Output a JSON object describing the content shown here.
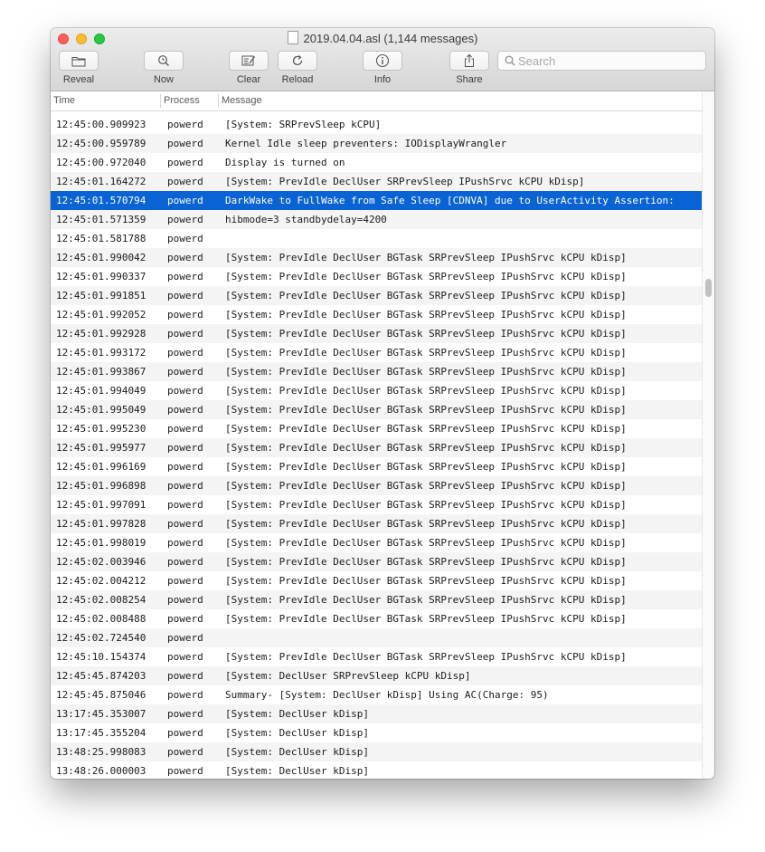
{
  "window": {
    "title": "2019.04.04.asl (1,144 messages)"
  },
  "toolbar": {
    "reveal_label": "Reveal",
    "now_label": "Now",
    "clear_label": "Clear",
    "reload_label": "Reload",
    "info_label": "Info",
    "share_label": "Share",
    "search_placeholder": "Search"
  },
  "columns": {
    "time": "Time",
    "process": "Process",
    "message": "Message"
  },
  "rows": [
    {
      "time": "12:45:00.909923",
      "process": "powerd",
      "message": "[System: SRPrevSleep kCPU]"
    },
    {
      "time": "12:45:00.959789",
      "process": "powerd",
      "message": "Kernel Idle sleep preventers: IODisplayWrangler"
    },
    {
      "time": "12:45:00.972040",
      "process": "powerd",
      "message": "Display is turned on"
    },
    {
      "time": "12:45:01.164272",
      "process": "powerd",
      "message": "[System: PrevIdle DeclUser SRPrevSleep IPushSrvc kCPU kDisp]"
    },
    {
      "time": "12:45:01.570794",
      "process": "powerd",
      "message": "DarkWake to FullWake from Safe Sleep [CDNVA] due to UserActivity Assertion:"
    },
    {
      "time": "12:45:01.571359",
      "process": "powerd",
      "message": "hibmode=3 standbydelay=4200"
    },
    {
      "time": "12:45:01.581788",
      "process": "powerd",
      "message": ""
    },
    {
      "time": "12:45:01.990042",
      "process": "powerd",
      "message": "[System: PrevIdle DeclUser BGTask SRPrevSleep IPushSrvc kCPU kDisp]"
    },
    {
      "time": "12:45:01.990337",
      "process": "powerd",
      "message": "[System: PrevIdle DeclUser BGTask SRPrevSleep IPushSrvc kCPU kDisp]"
    },
    {
      "time": "12:45:01.991851",
      "process": "powerd",
      "message": "[System: PrevIdle DeclUser BGTask SRPrevSleep IPushSrvc kCPU kDisp]"
    },
    {
      "time": "12:45:01.992052",
      "process": "powerd",
      "message": "[System: PrevIdle DeclUser BGTask SRPrevSleep IPushSrvc kCPU kDisp]"
    },
    {
      "time": "12:45:01.992928",
      "process": "powerd",
      "message": "[System: PrevIdle DeclUser BGTask SRPrevSleep IPushSrvc kCPU kDisp]"
    },
    {
      "time": "12:45:01.993172",
      "process": "powerd",
      "message": "[System: PrevIdle DeclUser BGTask SRPrevSleep IPushSrvc kCPU kDisp]"
    },
    {
      "time": "12:45:01.993867",
      "process": "powerd",
      "message": "[System: PrevIdle DeclUser BGTask SRPrevSleep IPushSrvc kCPU kDisp]"
    },
    {
      "time": "12:45:01.994049",
      "process": "powerd",
      "message": "[System: PrevIdle DeclUser BGTask SRPrevSleep IPushSrvc kCPU kDisp]"
    },
    {
      "time": "12:45:01.995049",
      "process": "powerd",
      "message": "[System: PrevIdle DeclUser BGTask SRPrevSleep IPushSrvc kCPU kDisp]"
    },
    {
      "time": "12:45:01.995230",
      "process": "powerd",
      "message": "[System: PrevIdle DeclUser BGTask SRPrevSleep IPushSrvc kCPU kDisp]"
    },
    {
      "time": "12:45:01.995977",
      "process": "powerd",
      "message": "[System: PrevIdle DeclUser BGTask SRPrevSleep IPushSrvc kCPU kDisp]"
    },
    {
      "time": "12:45:01.996169",
      "process": "powerd",
      "message": "[System: PrevIdle DeclUser BGTask SRPrevSleep IPushSrvc kCPU kDisp]"
    },
    {
      "time": "12:45:01.996898",
      "process": "powerd",
      "message": "[System: PrevIdle DeclUser BGTask SRPrevSleep IPushSrvc kCPU kDisp]"
    },
    {
      "time": "12:45:01.997091",
      "process": "powerd",
      "message": "[System: PrevIdle DeclUser BGTask SRPrevSleep IPushSrvc kCPU kDisp]"
    },
    {
      "time": "12:45:01.997828",
      "process": "powerd",
      "message": "[System: PrevIdle DeclUser BGTask SRPrevSleep IPushSrvc kCPU kDisp]"
    },
    {
      "time": "12:45:01.998019",
      "process": "powerd",
      "message": "[System: PrevIdle DeclUser BGTask SRPrevSleep IPushSrvc kCPU kDisp]"
    },
    {
      "time": "12:45:02.003946",
      "process": "powerd",
      "message": "[System: PrevIdle DeclUser BGTask SRPrevSleep IPushSrvc kCPU kDisp]"
    },
    {
      "time": "12:45:02.004212",
      "process": "powerd",
      "message": "[System: PrevIdle DeclUser BGTask SRPrevSleep IPushSrvc kCPU kDisp]"
    },
    {
      "time": "12:45:02.008254",
      "process": "powerd",
      "message": "[System: PrevIdle DeclUser BGTask SRPrevSleep IPushSrvc kCPU kDisp]"
    },
    {
      "time": "12:45:02.008488",
      "process": "powerd",
      "message": "[System: PrevIdle DeclUser BGTask SRPrevSleep IPushSrvc kCPU kDisp]"
    },
    {
      "time": "12:45:02.724540",
      "process": "powerd",
      "message": ""
    },
    {
      "time": "12:45:10.154374",
      "process": "powerd",
      "message": "[System: PrevIdle DeclUser BGTask SRPrevSleep IPushSrvc kCPU kDisp]"
    },
    {
      "time": "12:45:45.874203",
      "process": "powerd",
      "message": "[System: DeclUser SRPrevSleep kCPU kDisp]"
    },
    {
      "time": "12:45:45.875046",
      "process": "powerd",
      "message": "Summary- [System: DeclUser kDisp] Using AC(Charge: 95)"
    },
    {
      "time": "13:17:45.353007",
      "process": "powerd",
      "message": "[System: DeclUser kDisp]"
    },
    {
      "time": "13:17:45.355204",
      "process": "powerd",
      "message": "[System: DeclUser kDisp]"
    },
    {
      "time": "13:48:25.998083",
      "process": "powerd",
      "message": "[System: DeclUser kDisp]"
    },
    {
      "time": "13:48:26.000003",
      "process": "powerd",
      "message": "[System: DeclUser kDisp]"
    }
  ],
  "selected_row": 4,
  "colors": {
    "selection": "#0a63d4",
    "alt_row": "#f4f4f4",
    "close": "#fc5f57",
    "minimize": "#fdbc2e",
    "zoom": "#28c840"
  }
}
